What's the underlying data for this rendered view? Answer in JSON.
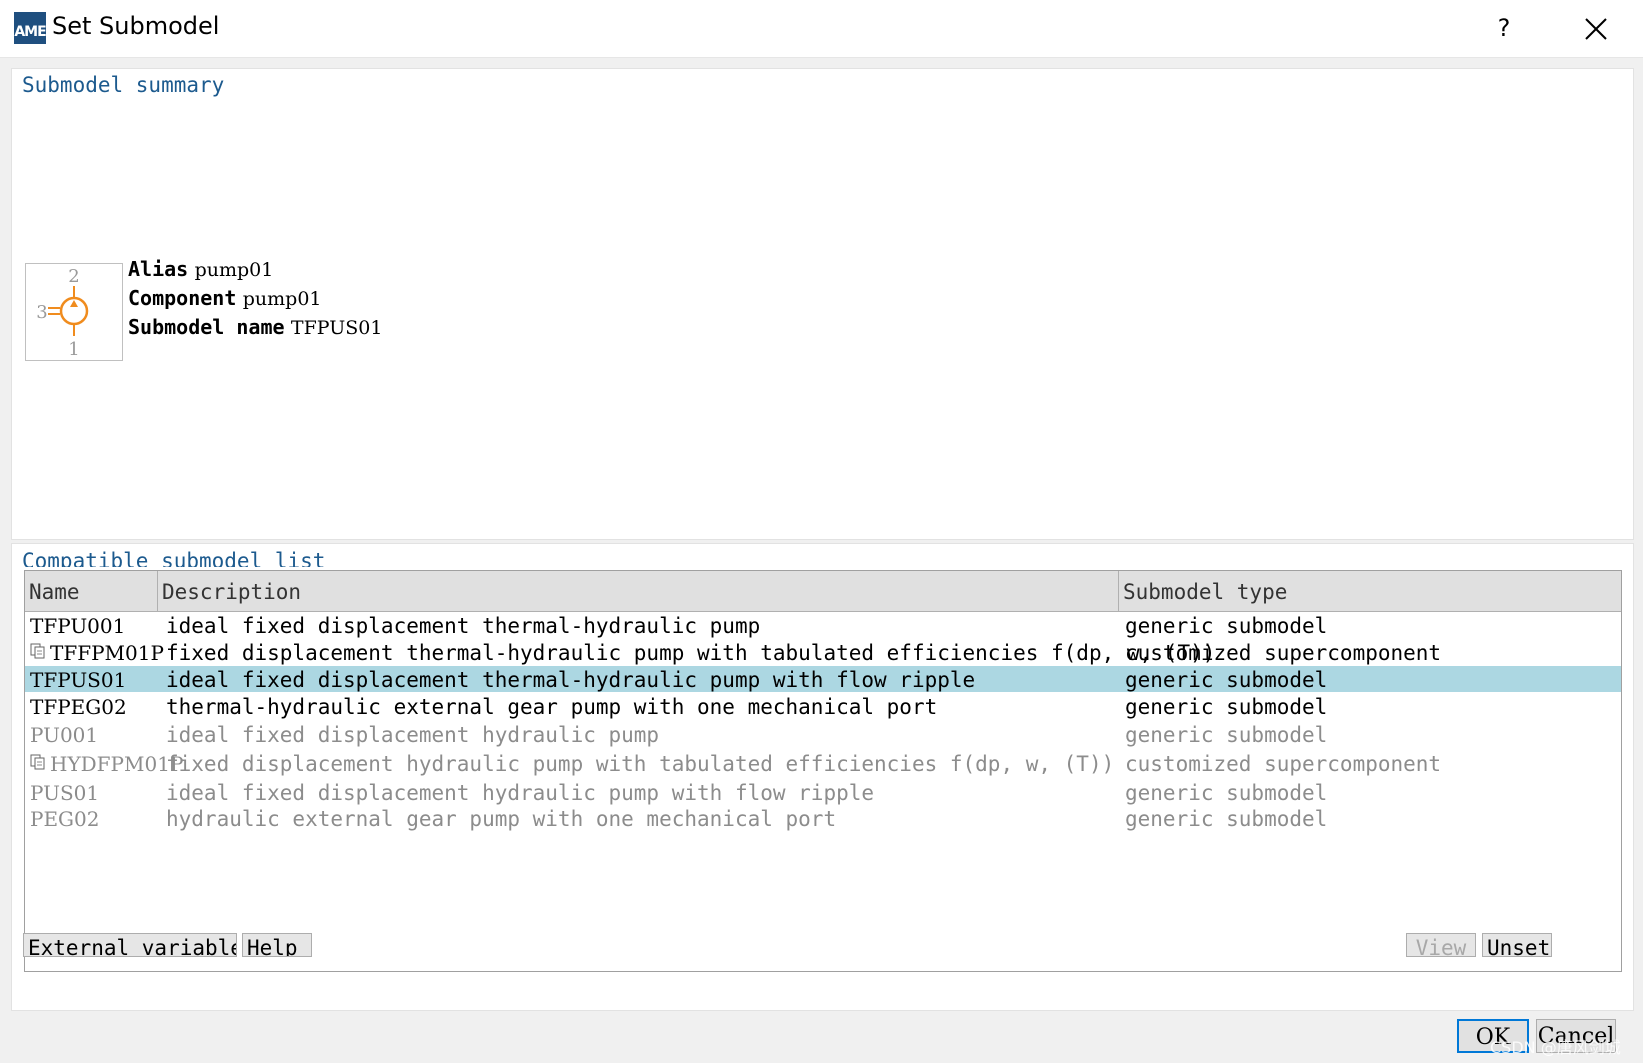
{
  "window": {
    "title": "Set Submodel",
    "app_icon_label": "AME",
    "help_label": "?"
  },
  "summary": {
    "title": "Submodel summary",
    "alias_label": "Alias",
    "alias_value": "pump01",
    "component_label": "Component",
    "component_value": "pump01",
    "submodel_name_label": "Submodel name",
    "submodel_name_value": "TFPUS01",
    "port_labels": [
      "2",
      "3",
      "1"
    ]
  },
  "list": {
    "title": "Compatible submodel list",
    "columns": [
      "Name",
      "Description",
      "Submodel type"
    ],
    "rows": [
      {
        "name": "TFPU001",
        "description": "ideal fixed displacement thermal-hydraulic pump",
        "type": "generic submodel",
        "active": true,
        "selected": false,
        "icon": ""
      },
      {
        "name": "TFFPM01P",
        "description": "fixed displacement thermal-hydraulic pump with tabulated efficiencies f(dp, w, (T))",
        "type": "customized supercomponent",
        "active": true,
        "selected": false,
        "icon": "document-icon"
      },
      {
        "name": "TFPUS01",
        "description": "ideal fixed displacement thermal-hydraulic pump with flow ripple",
        "type": "generic submodel",
        "active": true,
        "selected": true,
        "icon": ""
      },
      {
        "name": "TFPEG02",
        "description": "thermal-hydraulic external gear pump with one mechanical port",
        "type": "generic submodel",
        "active": true,
        "selected": false,
        "icon": ""
      },
      {
        "name": "PU001",
        "description": "ideal fixed displacement hydraulic pump",
        "type": "generic submodel",
        "active": false,
        "selected": false,
        "icon": ""
      },
      {
        "name": "HYDFPM01P",
        "description": "fixed displacement hydraulic pump with tabulated efficiencies f(dp, w, (T))",
        "type": "customized supercomponent",
        "active": false,
        "selected": false,
        "icon": "document-icon"
      },
      {
        "name": "PUS01",
        "description": "ideal fixed displacement hydraulic pump with flow ripple",
        "type": "generic submodel",
        "active": false,
        "selected": false,
        "icon": ""
      },
      {
        "name": "PEG02",
        "description": "hydraulic external gear pump with one mechanical port",
        "type": "generic submodel",
        "active": false,
        "selected": false,
        "icon": ""
      }
    ]
  },
  "buttons": {
    "external_variables": "External variables",
    "help": "Help",
    "view": "View",
    "unset": "Unset",
    "ok": "OK",
    "cancel": "Cancel"
  },
  "watermark": "CSDN @唐风剑城",
  "colors": {
    "accent": "#1c5a8e",
    "selection": "#acd7e2",
    "pump_symbol": "#f08c1e"
  }
}
